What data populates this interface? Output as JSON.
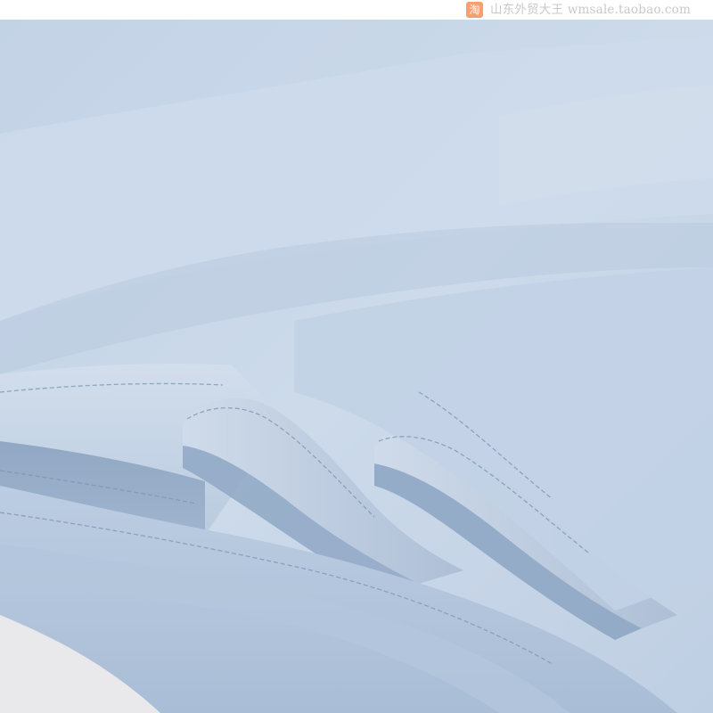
{
  "watermark": {
    "badge_glyph": "淘",
    "text": "山东外贸大王 wmsale.taobao.com"
  },
  "photo": {
    "subject": "light-blue-fabric-hem-folds",
    "colors": {
      "fabric_light": "#c9d7e8",
      "fabric_mid": "#b3c6dc",
      "fabric_shadow": "#8ea6c3",
      "fabric_deep": "#6f89a9",
      "background": "#f2f2f4",
      "badge": "#f5a06e"
    }
  }
}
